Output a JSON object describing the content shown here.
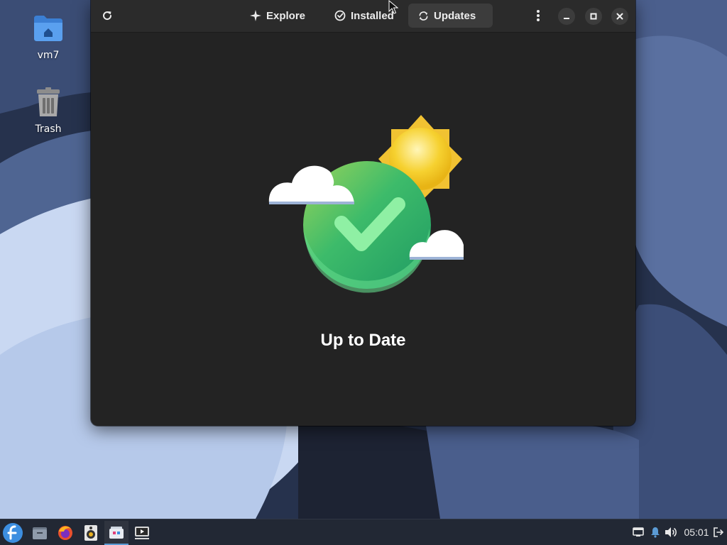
{
  "desktop": {
    "icons": [
      {
        "label": "vm7",
        "icon": "home-folder-icon"
      },
      {
        "label": "Trash",
        "icon": "trash-icon"
      }
    ]
  },
  "window": {
    "refresh_icon": "refresh-icon",
    "tabs": [
      {
        "label": "Explore",
        "icon": "sparkle-icon",
        "active": false
      },
      {
        "label": "Installed",
        "icon": "check-circle-icon",
        "active": false
      },
      {
        "label": "Updates",
        "icon": "sync-icon",
        "active": true
      }
    ],
    "menu_icon": "kebab-menu-icon",
    "controls": [
      "minimize-icon",
      "maximize-icon",
      "close-icon"
    ],
    "status": {
      "title": "Up to Date",
      "illustration": "sun-cloud-checkmark"
    }
  },
  "taskbar": {
    "launchers": [
      "fedora-start-icon",
      "files-icon",
      "firefox-icon",
      "rhythmbox-icon",
      "software-icon",
      "media-player-icon"
    ],
    "tray": {
      "clock": "05:01",
      "icons": [
        "network-icon",
        "notification-bell-icon",
        "volume-icon",
        "logout-icon"
      ]
    }
  },
  "colors": {
    "window_bg": "#232323",
    "headerbar_bg": "#2b2b2b",
    "active_tab_bg": "#3c3c3c",
    "taskbar_bg": "#222834",
    "accent": "#5b9bd5"
  }
}
